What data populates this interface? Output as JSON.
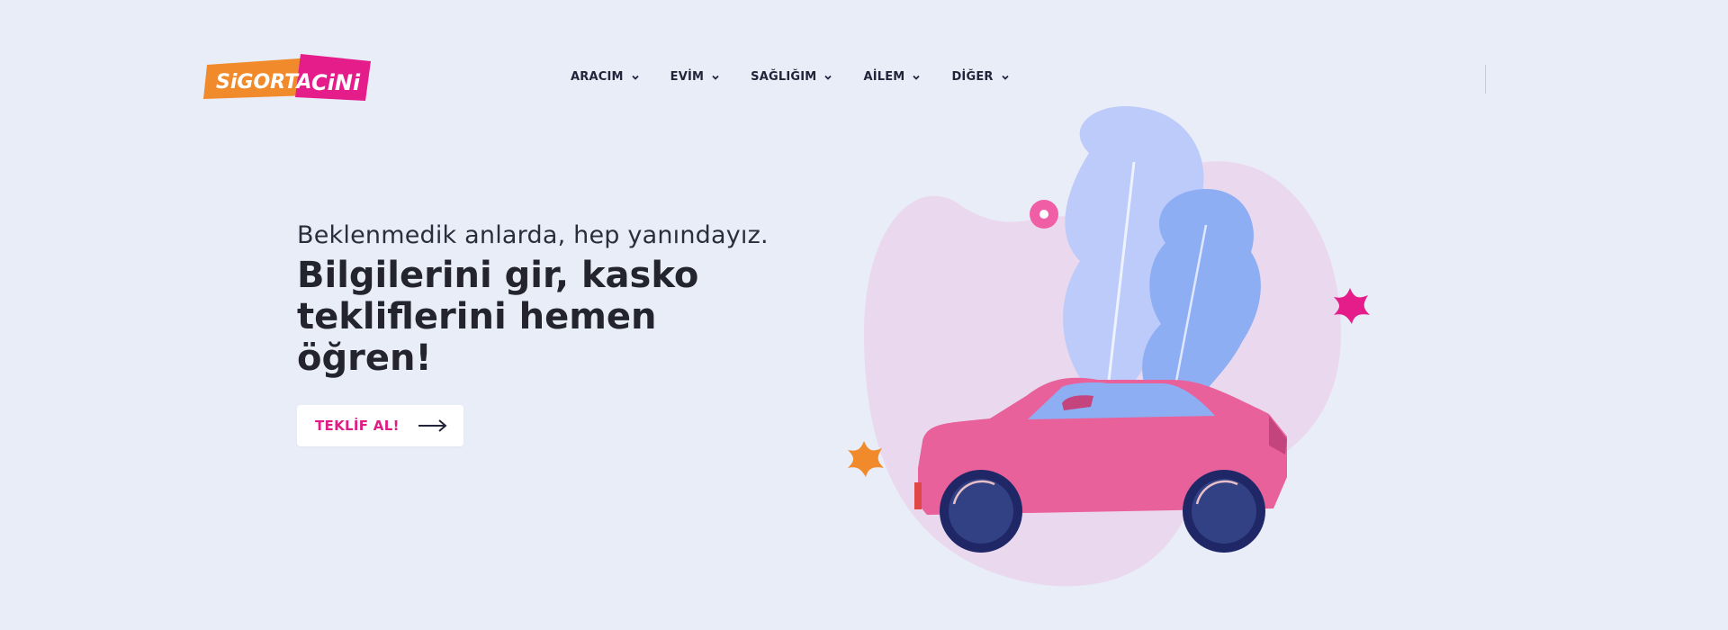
{
  "brand": {
    "logo_text_left": "SiGORTA",
    "logo_text_right": "CiNi",
    "colors": {
      "orange": "#f18a2b",
      "pink": "#e41d8b"
    }
  },
  "nav": {
    "items": [
      {
        "label": "ARACIM",
        "icon": "chevron-down-icon"
      },
      {
        "label": "EVİM",
        "icon": "chevron-down-icon"
      },
      {
        "label": "SAĞLIĞIM",
        "icon": "chevron-down-icon"
      },
      {
        "label": "AİLEM",
        "icon": "chevron-down-icon"
      },
      {
        "label": "DİĞER",
        "icon": "chevron-down-icon"
      }
    ]
  },
  "hero": {
    "tagline": "Beklenmedik anlarda, hep yanındayız.",
    "headline": "Bilgilerini gir, kasko tekliflerini hemen öğren!",
    "cta_label": "TEKLİF AL!",
    "cta_icon": "arrow-right-icon"
  },
  "illustration": {
    "subject": "car-with-leaves-illustration",
    "colors": {
      "car": "#e8619a",
      "wheel": "#1f2766",
      "leaf_light": "#bcccf8",
      "leaf_dark": "#8fb0f5",
      "blob": "#ead5ec"
    }
  }
}
